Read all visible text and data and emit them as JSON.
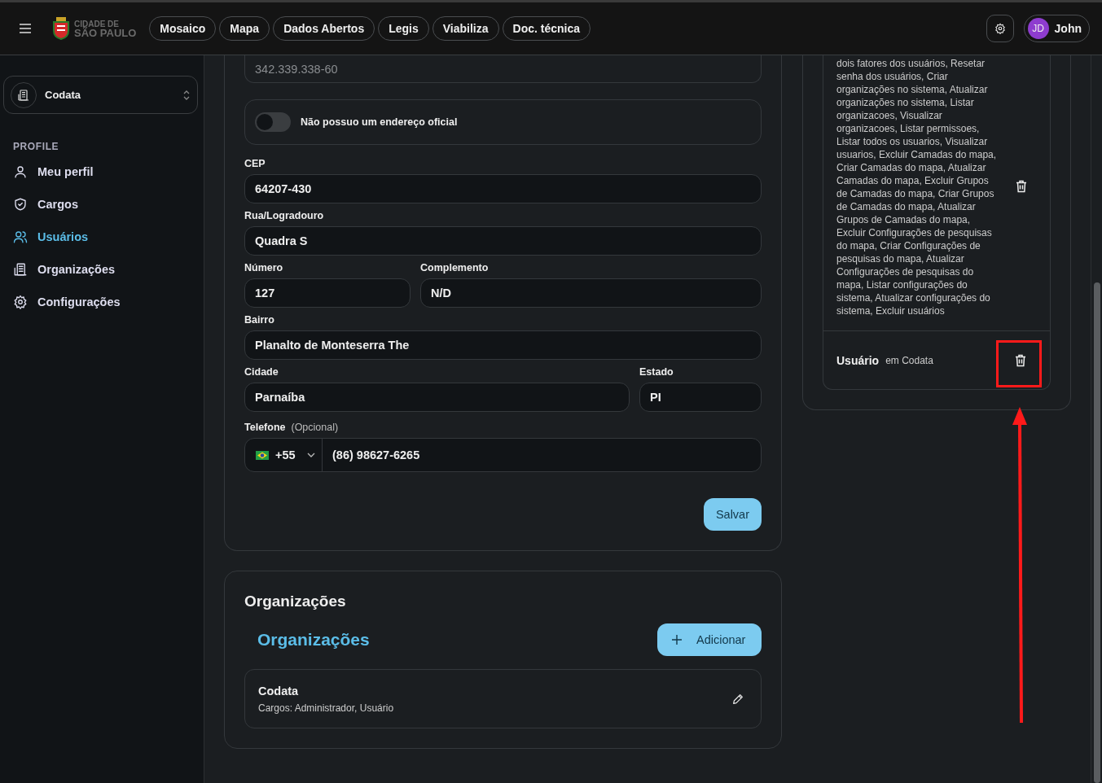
{
  "header": {
    "logo_text": [
      "CIDADE DE",
      "SÃO PAULO"
    ],
    "nav_links": [
      "Mosaico",
      "Mapa",
      "Dados Abertos",
      "Legis",
      "Viabiliza",
      "Doc. técnica"
    ],
    "user": {
      "initials": "JD",
      "name": "John"
    }
  },
  "sidebar": {
    "organization": "Codata",
    "section": "PROFILE",
    "items": [
      {
        "label": "Meu perfil",
        "selected": false
      },
      {
        "label": "Cargos",
        "selected": false
      },
      {
        "label": "Usuários",
        "selected": true
      },
      {
        "label": "Organizações",
        "selected": false
      },
      {
        "label": "Configurações",
        "selected": false
      }
    ]
  },
  "form": {
    "document": "342.339.338-60",
    "no_address": {
      "label": "Não possuo um endereço oficial",
      "on": false
    },
    "rows": [
      [
        {
          "label": "CEP",
          "value": "64207-430"
        }
      ],
      [
        {
          "label": "Rua/Logradouro",
          "value": "Quadra S"
        }
      ],
      [
        {
          "label": "Número",
          "value": "127"
        },
        {
          "label": "Complemento",
          "value": "N/D"
        }
      ],
      [
        {
          "label": "Bairro",
          "value": "Planalto de Monteserra The"
        }
      ],
      [
        {
          "label": "Cidade",
          "value": "Parnaíba"
        },
        {
          "label": "Estado",
          "value": "PI"
        }
      ]
    ],
    "phone": {
      "label": "Telefone",
      "note": "(Opcional)",
      "country_code": "+55",
      "number": "(86) 98627-6265"
    },
    "save": "Salvar"
  },
  "organizations": {
    "title": "Organizações",
    "subtitle": "Organizações",
    "add": "Adicionar",
    "items": [
      {
        "name": "Codata",
        "roles": "Cargos: Administrador, Usuário"
      }
    ]
  },
  "roles": [
    {
      "kind": "permissions",
      "text": "dois fatores dos usuários, Resetar senha dos usuários, Criar organizações no sistema, Atualizar organizações no sistema, Listar organizacoes, Visualizar organizacoes, Listar permissoes, Listar todos os usuarios, Visualizar usuarios, Excluir Camadas do mapa, Criar Camadas do mapa, Atualizar Camadas do mapa, Excluir Grupos de Camadas do mapa, Criar Grupos de Camadas do mapa, Atualizar Grupos de Camadas do mapa, Excluir Configurações de pesquisas do mapa, Criar Configurações de pesquisas do mapa, Atualizar Configurações de pesquisas do mapa, Listar configurações do sistema, Atualizar configurações do sistema, Excluir usuários"
    },
    {
      "kind": "role",
      "name": "Usuário",
      "org": "em Codata"
    }
  ]
}
